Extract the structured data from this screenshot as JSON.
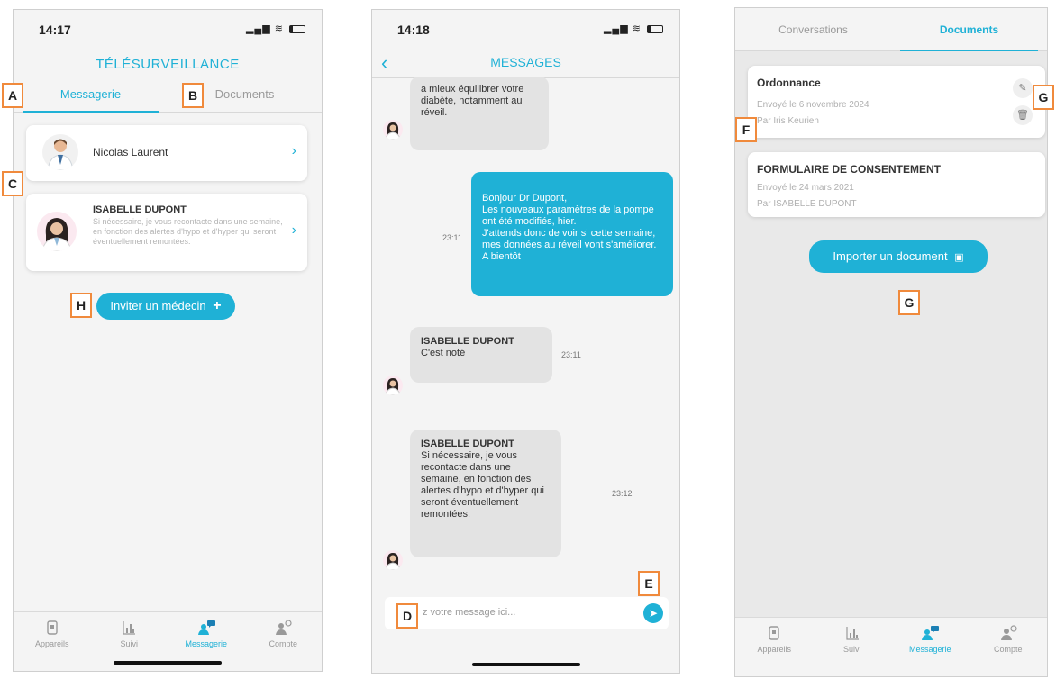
{
  "screens": {
    "messagerie": {
      "status_time": "14:17",
      "title": "TÉLÉSURVEILLANCE",
      "tabs": [
        "Messagerie",
        "Documents"
      ],
      "contacts": [
        {
          "name": "Nicolas Laurent",
          "preview": ""
        },
        {
          "name": "ISABELLE DUPONT",
          "preview": "Si nécessaire, je vous recontacte dans une semaine, en fonction des alertes d'hypo et d'hyper qui seront éventuellement remontées."
        }
      ],
      "invite_button": "Inviter un médecin"
    },
    "messages": {
      "status_time": "14:18",
      "title": "MESSAGES",
      "back_icon": "chevron-left-icon",
      "messages": [
        {
          "direction": "in",
          "sender": "",
          "text": "a mieux équilibrer votre diabète, notamment au réveil.",
          "time": ""
        },
        {
          "direction": "out",
          "sender": "",
          "text": "Bonjour Dr Dupont,\nLes nouveaux paramètres de la pompe ont été modifiés, hier.\nJ'attends donc de voir si cette semaine, mes données au réveil vont s'améliorer.\nA bientôt",
          "time": "23:11"
        },
        {
          "direction": "in",
          "sender": "ISABELLE DUPONT",
          "text": "C'est noté",
          "time": "23:11"
        },
        {
          "direction": "in",
          "sender": "ISABELLE DUPONT",
          "text": "Si nécessaire, je vous recontacte dans une semaine, en fonction des alertes d'hypo et d'hyper qui seront éventuellement remontées.",
          "time": "23:12"
        }
      ],
      "composer_placeholder": "z votre message ici..."
    },
    "documents": {
      "tabs": [
        "Conversations",
        "Documents"
      ],
      "documents": [
        {
          "title": "Ordonnance",
          "sent": "Envoyé le 6 novembre 2024",
          "by": "Par Iris Keurien"
        },
        {
          "title": "FORMULAIRE DE CONSENTEMENT",
          "sent": "Envoyé le 24 mars 2021",
          "by": "Par ISABELLE DUPONT"
        }
      ],
      "import_button": "Importer un document"
    }
  },
  "bottom_nav": [
    {
      "label": "Appareils",
      "icon": "device-icon"
    },
    {
      "label": "Suivi",
      "icon": "chart-icon"
    },
    {
      "label": "Messagerie",
      "icon": "messaging-icon"
    },
    {
      "label": "Compte",
      "icon": "account-icon"
    }
  ],
  "annotations": {
    "A": "A",
    "B": "B",
    "C": "C",
    "D": "D",
    "E": "E",
    "F": "F",
    "G": "G",
    "H": "H"
  },
  "colors": {
    "accent": "#1fb1d6",
    "annotation_border": "#f08a3c",
    "incoming_bubble": "#e3e3e3"
  }
}
